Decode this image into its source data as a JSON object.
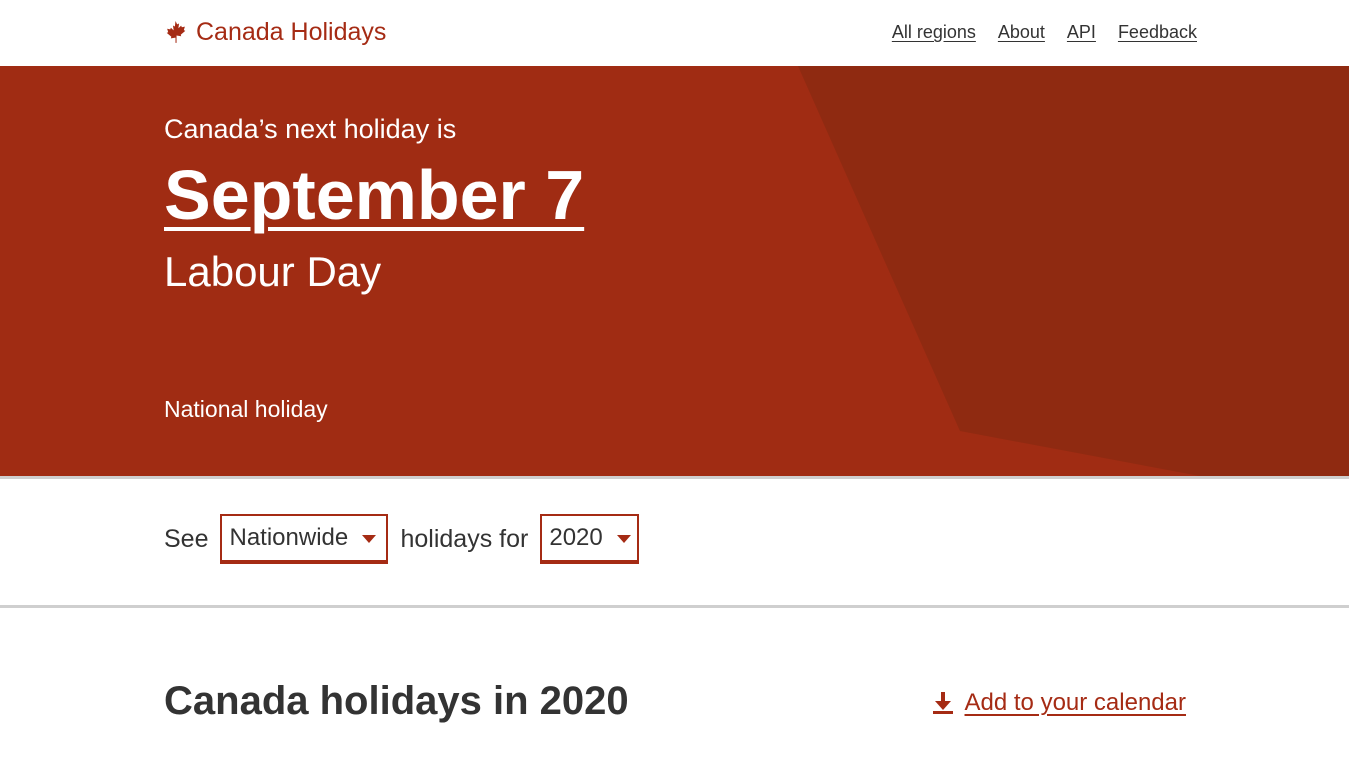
{
  "header": {
    "brand_icon": "maple-leaf-icon",
    "brand": "Canada Holidays",
    "nav": [
      {
        "label": "All regions"
      },
      {
        "label": "About"
      },
      {
        "label": "API"
      },
      {
        "label": "Feedback"
      }
    ]
  },
  "hero": {
    "kicker": "Canada’s next holiday is",
    "date": "September 7",
    "name": "Labour Day",
    "type": "National holiday"
  },
  "filters": {
    "prefix": "See",
    "region": "Nationwide",
    "middle": "holidays for",
    "year": "2020"
  },
  "section": {
    "title": "Canada holidays in 2020",
    "calendar_icon": "download-icon",
    "calendar_link": "Add to your calendar"
  },
  "colors": {
    "brand_red": "#a52b14",
    "hero_red": "#a02c13",
    "hero_dark": "#8f2a11",
    "text": "#333333",
    "divider": "#cfcfcf"
  }
}
